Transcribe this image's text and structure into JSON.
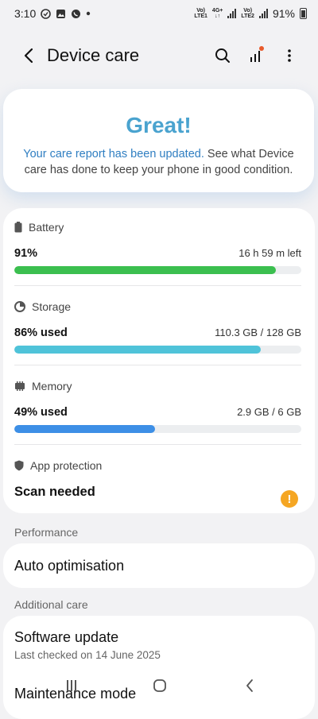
{
  "status_bar": {
    "time": "3:10",
    "sim1_label_top": "Vo)",
    "sim1_label_bottom": "LTE1",
    "net_label_top": "4G+",
    "net_label_bottom": "↓↑",
    "sim2_label_top": "Vo)",
    "sim2_label_bottom": "LTE2",
    "battery": "91%"
  },
  "app_bar": {
    "title": "Device care"
  },
  "hero": {
    "title": "Great!",
    "link_text": "Your care report has been updated.",
    "description": " See what Device care has done to keep your phone in good condition."
  },
  "battery": {
    "label": "Battery",
    "value": "91%",
    "detail": "16 h 59 m left",
    "level": 0.91,
    "color": "#3bbf4f"
  },
  "storage": {
    "label": "Storage",
    "value": "86% used",
    "detail": "110.3 GB / 128 GB",
    "level": 0.86,
    "color": "#4fc3d9"
  },
  "memory": {
    "label": "Memory",
    "value": "49% used",
    "detail": "2.9 GB / 6 GB",
    "level": 0.49,
    "color": "#3d8fe6"
  },
  "app_protection": {
    "label": "App protection",
    "value": "Scan needed",
    "warning_glyph": "!"
  },
  "performance": {
    "section_label": "Performance",
    "item": "Auto optimisation"
  },
  "additional_care": {
    "section_label": "Additional care",
    "software_update": "Software update",
    "software_update_sub": "Last checked on 14 June 2025",
    "maintenance_mode": "Maintenance mode"
  }
}
